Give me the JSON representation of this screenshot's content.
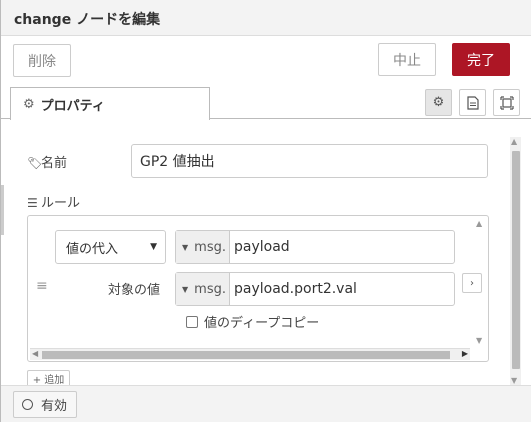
{
  "header": {
    "title": "change ノードを編集"
  },
  "toolbar": {
    "delete": "削除",
    "cancel": "中止",
    "done": "完了"
  },
  "tabs": {
    "properties": {
      "label": "プロパティ"
    }
  },
  "form": {
    "name_label": "名前",
    "name_value": "GP2 値抽出",
    "rules_label": "ルール",
    "rule": {
      "action": "値の代入",
      "target": {
        "prefix": "msg.",
        "value": "payload"
      },
      "value_label": "対象の値",
      "source": {
        "prefix": "msg.",
        "value": "payload.port2.val"
      },
      "deepcopy_label": "値のディープコピー",
      "deepcopy_checked": false
    },
    "add_label": "+ 追加"
  },
  "footer": {
    "enabled_label": "有効"
  },
  "colors": {
    "primary": "#ad1625"
  }
}
